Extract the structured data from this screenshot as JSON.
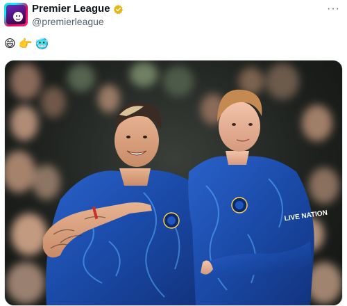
{
  "post": {
    "author_name": "Premier League",
    "author_handle": "@premierleague",
    "verified_icon": "verified-badge-gold",
    "more_label": "···",
    "emojis": [
      "😄",
      "👉",
      "🥶"
    ]
  },
  "photo": {
    "kit_colors": {
      "primary": "#1b4fb0",
      "swirl": "#4aa0ff"
    },
    "shirt_text": "LIVE NATION"
  }
}
